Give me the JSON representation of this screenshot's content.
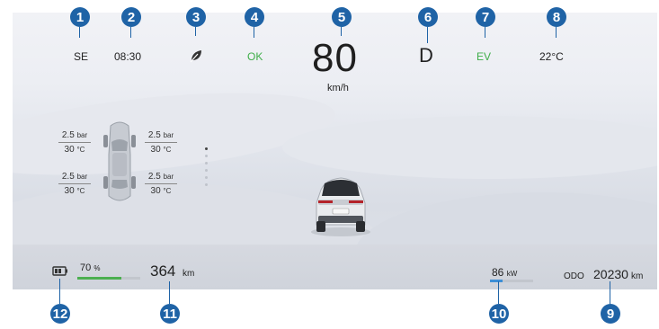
{
  "top_bar": {
    "heading": "SE",
    "time": "08:30",
    "eco_icon": "leaf-icon",
    "status": "OK",
    "speed": "80",
    "speed_unit": "km/h",
    "gear": "D",
    "mode": "EV",
    "temperature": "22°C"
  },
  "tires": [
    {
      "position": "front-left",
      "pressure": "2.5",
      "pressure_unit": "bar",
      "temp": "30",
      "temp_unit": "°C"
    },
    {
      "position": "front-right",
      "pressure": "2.5",
      "pressure_unit": "bar",
      "temp": "30",
      "temp_unit": "°C"
    },
    {
      "position": "rear-left",
      "pressure": "2.5",
      "pressure_unit": "bar",
      "temp": "30",
      "temp_unit": "°C"
    },
    {
      "position": "rear-right",
      "pressure": "2.5",
      "pressure_unit": "bar",
      "temp": "30",
      "temp_unit": "°C"
    }
  ],
  "bottom_bar": {
    "battery_icon": "battery-icon",
    "battery_percent": "70",
    "battery_percent_unit": "%",
    "battery_level": 0.7,
    "range": "364",
    "range_unit": "km",
    "power": "86",
    "power_unit": "kW",
    "power_level": 0.3,
    "odo_label": "ODO",
    "odometer": "20230",
    "odo_unit": "km"
  },
  "markers": [
    "1",
    "2",
    "3",
    "4",
    "5",
    "6",
    "7",
    "8",
    "9",
    "10",
    "11",
    "12"
  ],
  "colors": {
    "status_ok": "#3fae49",
    "mode_ev": "#3fae49",
    "marker": "#1f63a6",
    "battery_bar": "#4caf50",
    "power_bar": "#3d8fd6"
  }
}
